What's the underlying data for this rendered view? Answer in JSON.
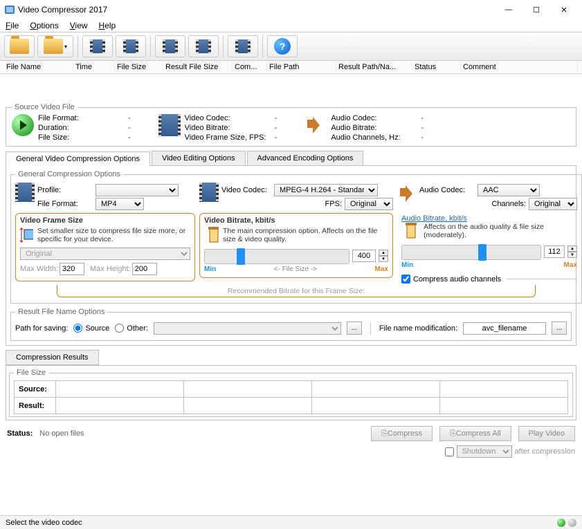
{
  "app": {
    "title": "Video Compressor 2017"
  },
  "menu": {
    "file": "File",
    "options": "Options",
    "view": "View",
    "help": "Help"
  },
  "cols": {
    "fname": "File Name",
    "time": "Time",
    "fsize": "File Size",
    "rfs": "Result File Size",
    "com": "Com...",
    "fpath": "File Path",
    "rpn": "Result Path/Na...",
    "status": "Status",
    "comment": "Comment"
  },
  "src": {
    "legend": "Source Video File",
    "fileformat": "File Format:",
    "fileformat_v": "-",
    "duration": "Duration:",
    "duration_v": "-",
    "filesize": "File Size:",
    "filesize_v": "-",
    "vcodec": "Video Codec:",
    "vcodec_v": "-",
    "vbitrate": "Video Bitrate:",
    "vbitrate_v": "-",
    "vfs": "Video Frame Size, FPS:",
    "vfs_v": "-",
    "acodec": "Audio Codec:",
    "acodec_v": "-",
    "abitrate": "Audio Bitrate:",
    "abitrate_v": "-",
    "ach": "Audio Channels, Hz:",
    "ach_v": "-"
  },
  "tabs": {
    "t1": "General Video Compression Options",
    "t2": "Video Editing Options",
    "t3": "Advanced Encoding Options"
  },
  "gco": {
    "legend": "General Compression Options",
    "profile": "Profile:",
    "profile_v": "",
    "fileformat": "File Format:",
    "fileformat_v": "MP4",
    "vcodec": "Video Codec:",
    "vcodec_v": "MPEG-4 H.264 - Standar",
    "fps": "FPS:",
    "fps_v": "Original",
    "acodec": "Audio Codec:",
    "acodec_v": "AAC",
    "channels": "Channels:",
    "channels_v": "Original"
  },
  "vfs": {
    "title": "Video Frame Size",
    "hint": "Set smaller size to compress file size more, or specific for your device.",
    "preset": "Original",
    "maxw_lbl": "Max Width:",
    "maxw": "320",
    "maxh_lbl": "Max Height:",
    "maxh": "200"
  },
  "vbr": {
    "title": "Video Bitrate, kbit/s",
    "hint": "The main compression option. Affects on the file size & video quality.",
    "value": "400",
    "min": "Min",
    "max": "Max",
    "mid": "<-   File Size   ->"
  },
  "abr": {
    "title": "Audio Bitrate, kbit/s",
    "hint": "Affects on the audio quality & file size (moderately).",
    "value": "112",
    "min": "Min",
    "max": "Max",
    "compress_ch": "Compress audio channels"
  },
  "rec": "Recommended Bitrate for this Frame Size:",
  "rfno": {
    "legend": "Result File Name Options",
    "path": "Path for saving:",
    "source": "Source",
    "other": "Other:",
    "fnm": "File name modification:",
    "fnm_v": "avc_filename"
  },
  "cr": {
    "tab": "Compression Results",
    "legend": "File Size",
    "source": "Source:",
    "result": "Result:"
  },
  "bottom": {
    "status_lbl": "Status:",
    "status": "No open files",
    "compress": "Compress",
    "compress_all": "Compress All",
    "play": "Play Video",
    "shutdown": "Shutdown",
    "after": "after compression"
  },
  "statusbar": "Select the video codec"
}
